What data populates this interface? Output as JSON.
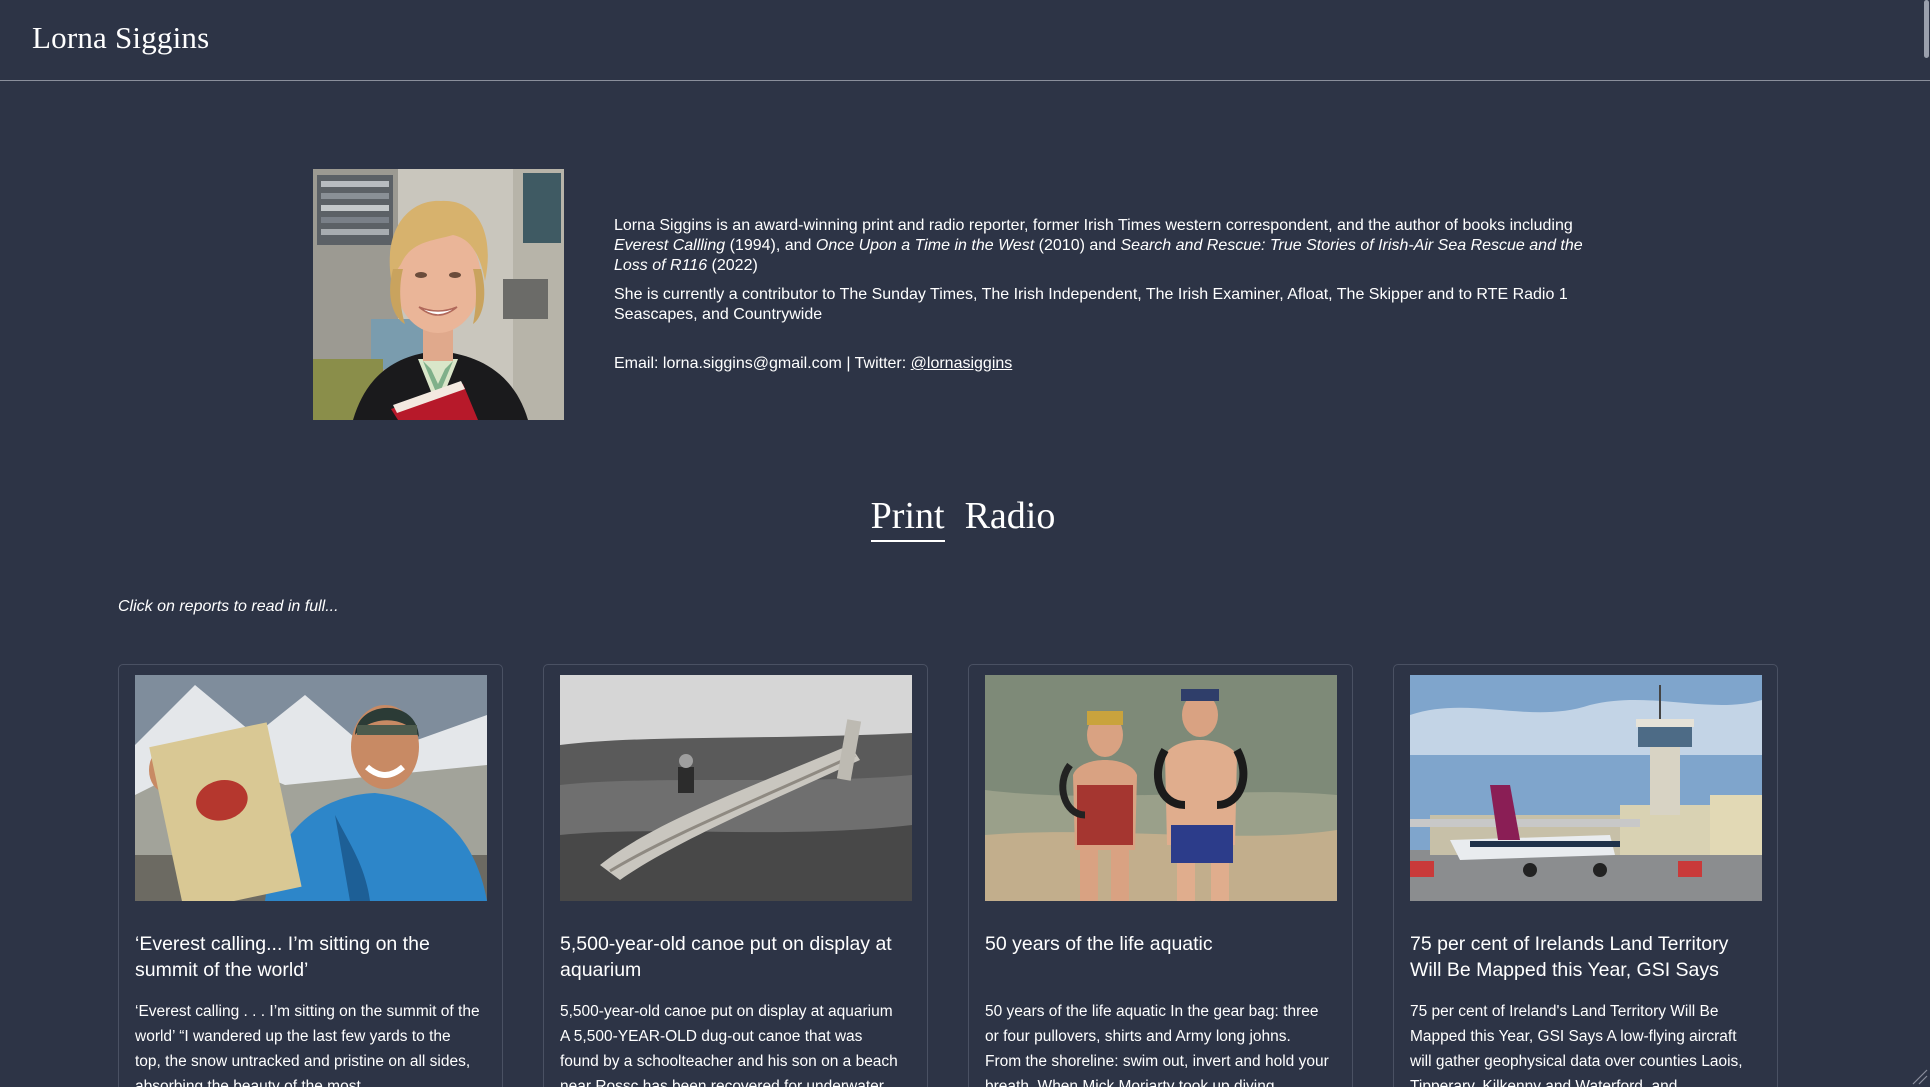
{
  "header": {
    "site_title": "Lorna Siggins"
  },
  "bio": {
    "portrait_alt": "Portrait of Lorna Siggins",
    "intro_text_1": "Lorna Siggins is an award-winning print and radio reporter, former Irish Times western correspondent, and the author of books including ",
    "book_1": "Everest Callling",
    "year_1": " (1994), and ",
    "book_2": "Once Upon a Time in the West",
    "year_2": " (2010) and ",
    "book_3": "Search and Rescue: True Stories of Irish-Air Sea Rescue and the Loss of R116",
    "year_3": " (2022)",
    "contributor_text": "She is currently a contributor to The Sunday Times, The Irish Independent, The Irish Examiner, Afloat, The Skipper and to RTE Radio 1 Seascapes, and Countrywide",
    "email_text": "Email: lorna.siggins@gmail.com | Twitter: ",
    "twitter_handle": "@lornasiggins"
  },
  "tabs": [
    {
      "label": "Print",
      "active": true
    },
    {
      "label": "Radio",
      "active": false
    }
  ],
  "hint": "Click on reports to read in full...",
  "reports": [
    {
      "title": "‘Everest calling... I’m sitting on the summit of the world’",
      "excerpt": "‘Everest calling . . . I’m sitting on the summit of the world’ “I wandered up the last few yards to the top, the snow untracked and pristine on all sides, absorbing the beauty of the most",
      "image_icon": "mountaineer-photo"
    },
    {
      "title": "5,500-year-old canoe put on display at aquarium",
      "excerpt": "5,500-year-old canoe put on display at aquarium A 5,500-YEAR-OLD dug-out canoe that was found by a schoolteacher and his son on a beach near Rossc has been recovered for underwater",
      "image_icon": "canoe-photo"
    },
    {
      "title": "50 years of the life aquatic",
      "excerpt": "50 years of the life aquatic In the gear bag: three or four pullovers, shirts and Army long johns. From the shoreline: swim out, invert and hold your breath. When Mick Moriarty took up diving",
      "image_icon": "divers-photo"
    },
    {
      "title": "75 per cent of Irelands Land Territory Will Be Mapped this Year, GSI Says",
      "excerpt": "75 per cent of Ireland's Land Territory Will Be Mapped this Year, GSI Says A low-flying aircraft will gather geophysical data over counties Laois, Tipperary, Kilkenny and Waterford, and",
      "image_icon": "aircraft-photo"
    }
  ]
}
